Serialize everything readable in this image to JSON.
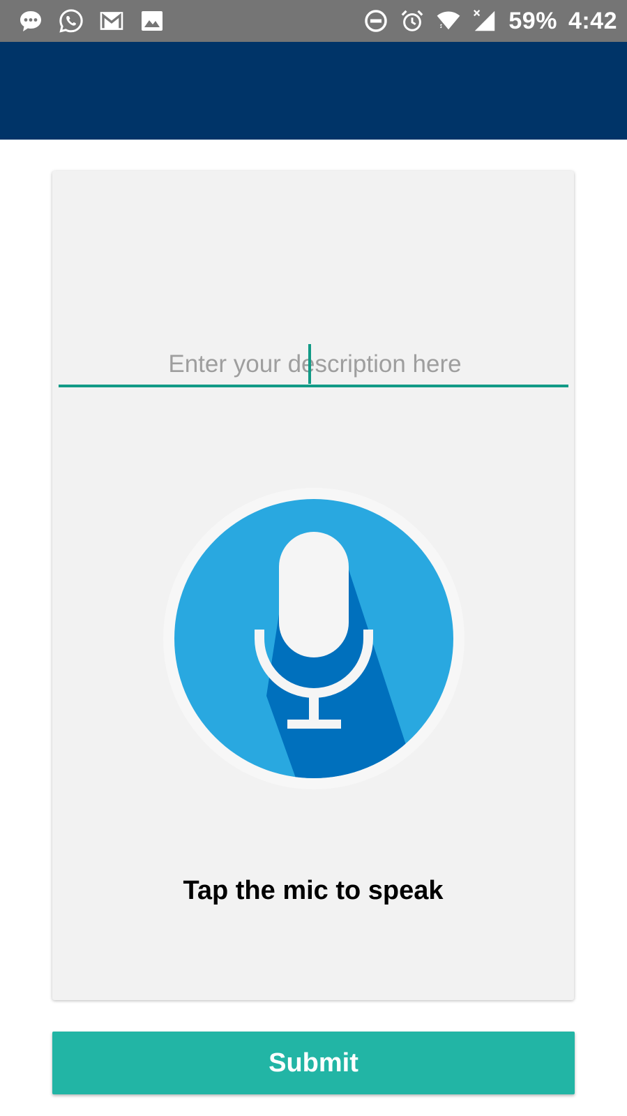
{
  "status_bar": {
    "battery_percent": "59%",
    "time": "4:42",
    "left_icons": [
      "message-icon",
      "whatsapp-icon",
      "gmail-icon",
      "gallery-icon"
    ],
    "right_icons": [
      "dnd-icon",
      "alarm-icon",
      "wifi-icon",
      "cell-signal-icon"
    ]
  },
  "colors": {
    "status_bar": "#757575",
    "app_bar": "#003468",
    "card_background": "#f2f2f2",
    "accent": "#129a86",
    "submit": "#22b5a5",
    "mic_circle": "#29a8e0",
    "mic_shadow": "#0070bd"
  },
  "description": {
    "placeholder": "Enter your description here",
    "value": ""
  },
  "mic": {
    "icon": "microphone-icon",
    "caption": "Tap the mic to speak"
  },
  "submit": {
    "label": "Submit"
  }
}
